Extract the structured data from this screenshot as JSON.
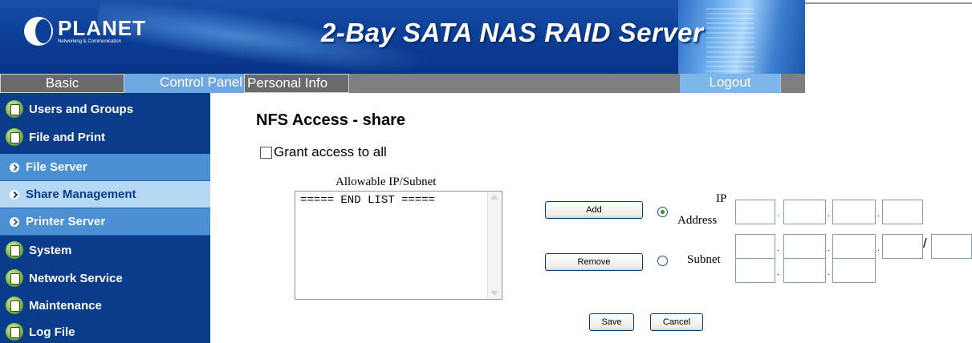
{
  "banner": {
    "brand": "PLANET",
    "tagline": "Networking & Communication",
    "title": "2-Bay SATA NAS RAID Server"
  },
  "nav": {
    "tabs": [
      "Basic",
      "Control Panel",
      "Personal Info"
    ],
    "logout": "Logout"
  },
  "sidebar": {
    "items": [
      {
        "label": "Users and Groups",
        "icon": "folder-person-icon"
      },
      {
        "label": "File and Print",
        "icon": "folder-person-icon"
      },
      {
        "label": "File Server",
        "icon": "chevron-right-icon"
      },
      {
        "label": "Share Management",
        "icon": "chevron-right-icon",
        "active": true
      },
      {
        "label": "Printer Server",
        "icon": "chevron-right-icon"
      },
      {
        "label": "System",
        "icon": "folder-person-icon"
      },
      {
        "label": "Network Service",
        "icon": "folder-person-icon"
      },
      {
        "label": "Maintenance",
        "icon": "folder-person-icon"
      },
      {
        "label": "Log File",
        "icon": "folder-person-icon"
      }
    ]
  },
  "main": {
    "title": "NFS Access - share",
    "grant_label": "Grant access to all",
    "grant_checked": false,
    "list_label": "Allowable IP/Subnet",
    "list_items": [
      "===== END LIST ====="
    ],
    "add_label": "Add",
    "remove_label": "Remove",
    "ip_label_line1": "IP",
    "ip_label_line2": "Address",
    "subnet_label": "Subnet",
    "selected_mode": "ip",
    "save_label": "Save",
    "cancel_label": "Cancel"
  },
  "colors": {
    "banner_blue": "#0c3f98",
    "sidebar_blue": "#0a3c8c",
    "submenu_blue": "#4a90d2",
    "active_submenu": "#b7d8f3",
    "nav_gray": "#7f7f7f"
  }
}
